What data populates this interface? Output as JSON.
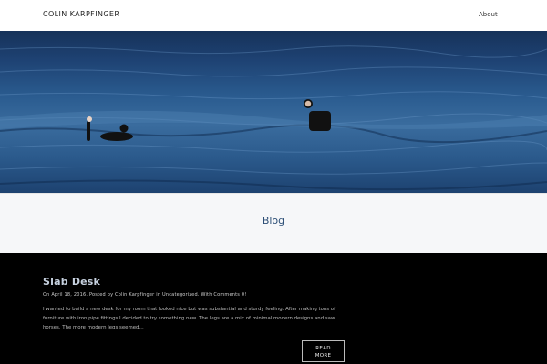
{
  "header": {
    "site_title": "COLIN KARPFINGER",
    "nav": [
      {
        "label": "About"
      }
    ]
  },
  "hero": {
    "image_icon": "surfers-in-ocean-photo"
  },
  "blog_section": {
    "heading": "Blog"
  },
  "post": {
    "title": "Slab Desk",
    "meta": {
      "prefix": "On",
      "date": "April 18, 2016",
      "posted_by_label": "Posted by",
      "author": "Colin Karpfinger",
      "in_label": "in",
      "category": "Uncategorized",
      "comments": "With Comments 0!"
    },
    "excerpt": "I wanted to build a new desk for my room that looked nice but was substantial and sturdy feeling. After making tons of furniture with iron pipe fittings I decided to try something new. The legs are a mix of minimal modern designs and saw horses. The more modern legs seemed…",
    "read_more_line1": "READ",
    "read_more_line2": "MORE"
  }
}
